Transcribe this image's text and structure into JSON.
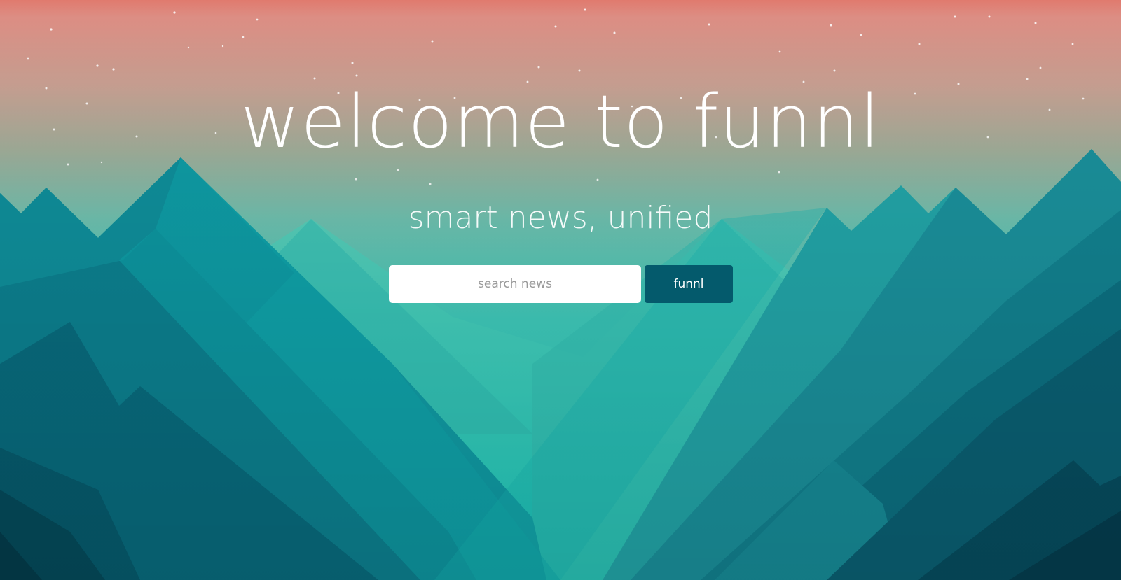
{
  "hero": {
    "title": "welcome to funnl",
    "subtitle": "smart news, unified"
  },
  "search": {
    "placeholder": "search news",
    "value": "",
    "button_label": "funnl"
  },
  "colors": {
    "sky_top": "#e07a6e",
    "sky_mid": "#c4a59a",
    "horizon": "#5dc4b0",
    "mountain_light": "#1cc9bb",
    "mountain_dark": "#0b4a5c",
    "button": "#045a6c"
  }
}
